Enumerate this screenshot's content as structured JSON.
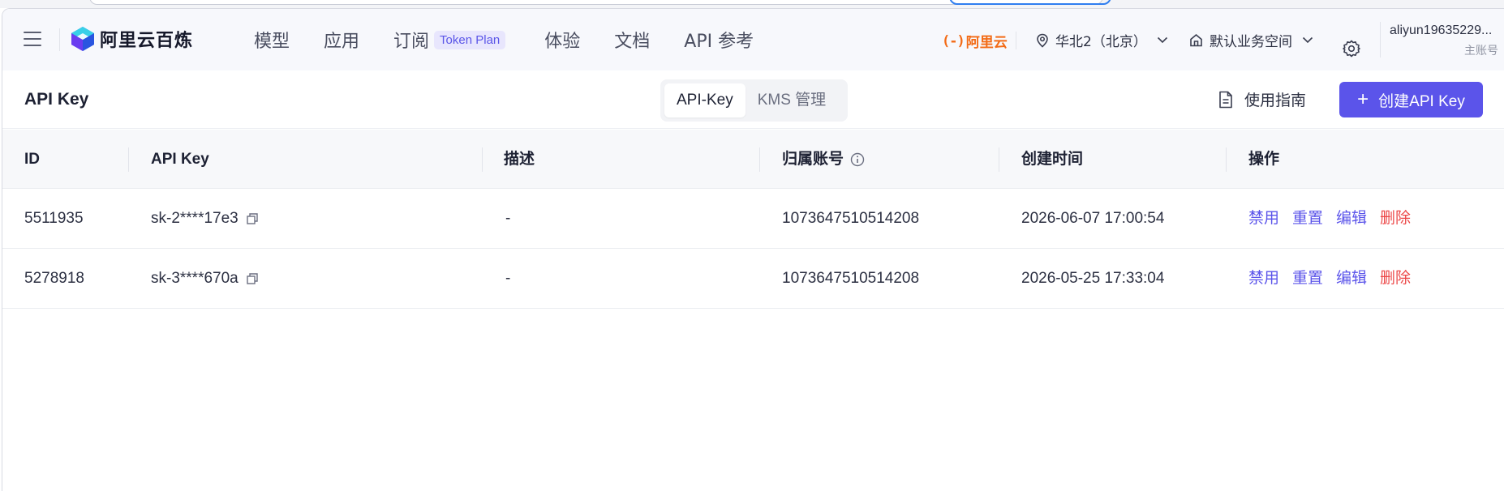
{
  "header": {
    "brand": "阿里云百炼",
    "nav": [
      {
        "label": "模型"
      },
      {
        "label": "应用"
      },
      {
        "label": "订阅",
        "badge": "Token Plan"
      },
      {
        "label": "体验"
      },
      {
        "label": "文档"
      },
      {
        "label": "API 参考"
      }
    ],
    "aliyun_mark": "(-)",
    "aliyun_label": "阿里云",
    "region": "华北2（北京）",
    "workspace": "默认业务空间",
    "account_name": "aliyun19635229...",
    "account_role": "主账号"
  },
  "page": {
    "title": "API Key",
    "tabs": [
      "API-Key",
      "KMS 管理"
    ],
    "active_tab": "API-Key",
    "guide_label": "使用指南",
    "create_label": "创建API Key"
  },
  "table": {
    "columns": [
      "ID",
      "API Key",
      "描述",
      "归属账号",
      "创建时间",
      "操作"
    ],
    "rows": [
      {
        "id": "5511935",
        "key": "sk-2****17e3",
        "desc": "-",
        "account": "1073647510514208",
        "created": "2026-06-07 17:00:54"
      },
      {
        "id": "5278918",
        "key": "sk-3****670a",
        "desc": "-",
        "account": "1073647510514208",
        "created": "2026-05-25 17:33:04"
      }
    ],
    "actions": [
      "禁用",
      "重置",
      "编辑",
      "删除"
    ]
  },
  "colors": {
    "accent": "#5b54ea",
    "danger": "#ec4747",
    "aliyun_orange": "#f36b16"
  }
}
